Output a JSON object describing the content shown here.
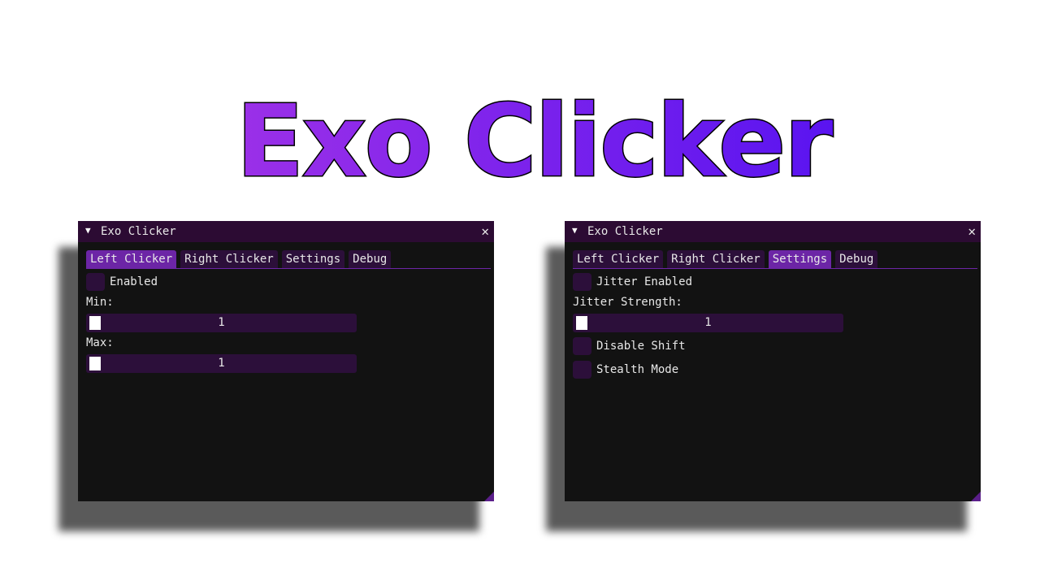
{
  "banner": {
    "text": "Exo Clicker",
    "color_start": "#9b30e8",
    "color_end": "#5a14f0",
    "outline": "#000000"
  },
  "windows": [
    {
      "title": "Exo Clicker",
      "collapse_glyph": "▼",
      "close_glyph": "✕",
      "tabs": [
        "Left Clicker",
        "Right Clicker",
        "Settings",
        "Debug"
      ],
      "active_tab": "Left Clicker",
      "enabled_label": "Enabled",
      "min_label": "Min:",
      "min_value": "1",
      "max_label": "Max:",
      "max_value": "1"
    },
    {
      "title": "Exo Clicker",
      "collapse_glyph": "▼",
      "close_glyph": "✕",
      "tabs": [
        "Left Clicker",
        "Right Clicker",
        "Settings",
        "Debug"
      ],
      "active_tab": "Settings",
      "jitter_enabled_label": "Jitter Enabled",
      "jitter_strength_label": "Jitter Strength:",
      "jitter_strength_value": "1",
      "disable_shift_label": "Disable Shift",
      "stealth_mode_label": "Stealth Mode"
    }
  ],
  "colors": {
    "window_bg": "#121212",
    "titlebar": "#2c0b33",
    "frame": "#2c0f3a",
    "accent": "#6c25a6"
  }
}
